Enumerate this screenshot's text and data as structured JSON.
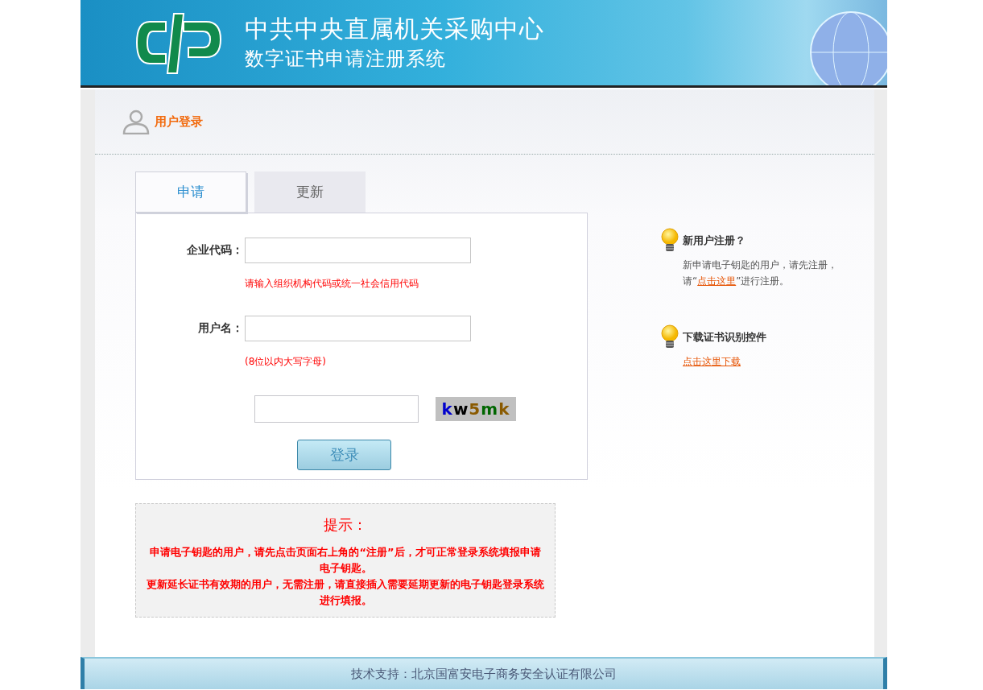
{
  "header": {
    "title": "中共中央直属机关采购中心",
    "subtitle": "数字证书申请注册系统"
  },
  "section_title": "用户登录",
  "tabs": [
    {
      "label": "申请",
      "selected": true
    },
    {
      "label": "更新",
      "selected": false
    }
  ],
  "form": {
    "fields": [
      {
        "label": "企业代码：",
        "hint": "请输入组织机构代码或统一社会信用代码"
      },
      {
        "label": "用户名：",
        "hint": "(8位以内大写字母)"
      }
    ],
    "captcha": "kw5mk",
    "button": "登录"
  },
  "side": [
    {
      "kind": "note",
      "title": "新用户注册？",
      "text_before": "新申请电子钥匙的用户，请先注册，请“",
      "link": "点击这里",
      "text_after": "”进行注册。"
    },
    {
      "kind": "link",
      "title": "下载证书识别控件",
      "link": "点击这里下载"
    }
  ],
  "notice": {
    "title": "提示：",
    "paragraphs": [
      "申请电子钥匙的用户，请先点击页面右上角的“注册”后，才可正常登录系统填报申请电子钥匙。",
      "更新延长证书有效期的用户，无需注册，请直接插入需要延期更新的电子钥匙登录系统进行填报。"
    ]
  },
  "footer": "技术支持：北京国富安电子商务安全认证有限公司"
}
